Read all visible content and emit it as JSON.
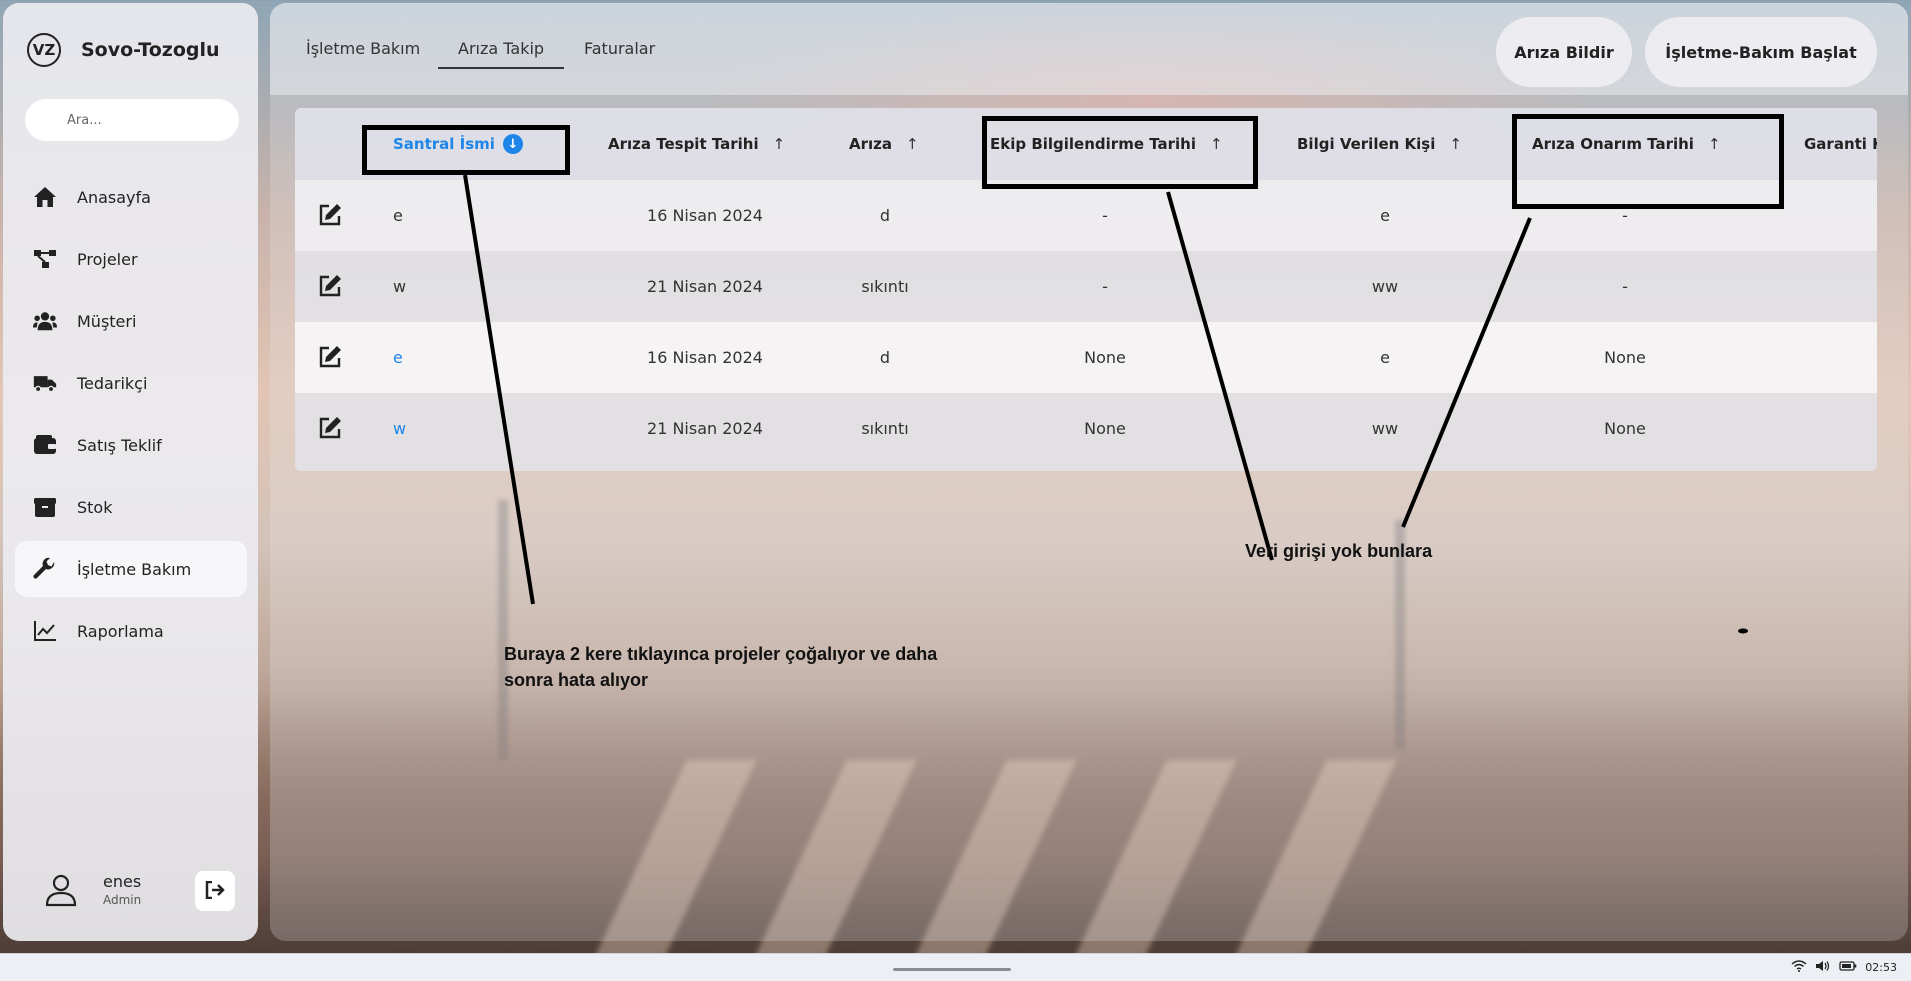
{
  "brand": {
    "logo_text": "VZ",
    "name": "Sovo-Tozoglu"
  },
  "search": {
    "placeholder": "Ara..."
  },
  "nav": [
    {
      "label": "Anasayfa",
      "icon": "home-icon"
    },
    {
      "label": "Projeler",
      "icon": "hierarchy-icon"
    },
    {
      "label": "Müşteri",
      "icon": "users-icon"
    },
    {
      "label": "Tedarikçi",
      "icon": "truck-icon"
    },
    {
      "label": "Satış Teklif",
      "icon": "wallet-icon"
    },
    {
      "label": "Stok",
      "icon": "box-icon"
    },
    {
      "label": "İşletme Bakım",
      "icon": "wrench-icon",
      "active": true
    },
    {
      "label": "Raporlama",
      "icon": "chart-line-icon"
    }
  ],
  "user": {
    "name": "enes",
    "role": "Admin"
  },
  "tabs": [
    {
      "label": "İşletme Bakım"
    },
    {
      "label": "Arıza Takip",
      "active": true
    },
    {
      "label": "Faturalar"
    }
  ],
  "actions": {
    "report_fault": "Arıza Bildir",
    "start_maintenance": "İşletme-Bakım Başlat"
  },
  "table": {
    "columns": [
      {
        "label": "Santral İsmi",
        "sort": "desc-active"
      },
      {
        "label": "Arıza Tespit Tarihi",
        "sort": "asc"
      },
      {
        "label": "Arıza",
        "sort": "asc"
      },
      {
        "label": "Ekip Bilgilendirme Tarihi",
        "sort": "asc"
      },
      {
        "label": "Bilgi Verilen Kişi",
        "sort": "asc"
      },
      {
        "label": "Arıza Onarım Tarihi",
        "sort": "asc"
      },
      {
        "label": "Garanti K"
      }
    ],
    "rows": [
      {
        "name": "e",
        "detect_date": "16 Nisan 2024",
        "fault": "d",
        "team_date": "-",
        "informed": "e",
        "repair_date": "-",
        "link": false
      },
      {
        "name": "w",
        "detect_date": "21 Nisan 2024",
        "fault": "sıkıntı",
        "team_date": "-",
        "informed": "ww",
        "repair_date": "-",
        "link": false
      },
      {
        "name": "e",
        "detect_date": "16 Nisan 2024",
        "fault": "d",
        "team_date": "None",
        "informed": "e",
        "repair_date": "None",
        "link": true
      },
      {
        "name": "w",
        "detect_date": "21 Nisan 2024",
        "fault": "sıkıntı",
        "team_date": "None",
        "informed": "ww",
        "repair_date": "None",
        "link": true
      }
    ]
  },
  "annotations": {
    "double_click_note_line1": "Buraya 2 kere  tıklayınca projeler çoğalıyor ve daha",
    "double_click_note_line2": "sonra hata alıyor",
    "no_data_note": "Veri girişi yok bunlara"
  },
  "taskbar": {
    "time": "02:53"
  }
}
